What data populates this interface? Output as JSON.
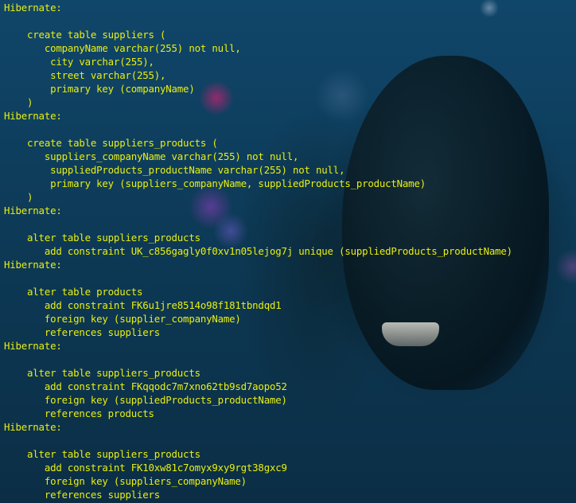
{
  "terminal": {
    "lines": [
      "Hibernate:",
      "",
      "    create table suppliers (",
      "       companyName varchar(255) not null,",
      "        city varchar(255),",
      "        street varchar(255),",
      "        primary key (companyName)",
      "    )",
      "Hibernate:",
      "",
      "    create table suppliers_products (",
      "       suppliers_companyName varchar(255) not null,",
      "        suppliedProducts_productName varchar(255) not null,",
      "        primary key (suppliers_companyName, suppliedProducts_productName)",
      "    )",
      "Hibernate:",
      "",
      "    alter table suppliers_products",
      "       add constraint UK_c856gagly0f0xv1n05lejog7j unique (suppliedProducts_productName)",
      "Hibernate:",
      "",
      "    alter table products",
      "       add constraint FK6u1jre8514o98f181tbndqd1",
      "       foreign key (supplier_companyName)",
      "       references suppliers",
      "Hibernate:",
      "",
      "    alter table suppliers_products",
      "       add constraint FKqqodc7m7xno62tb9sd7aopo52",
      "       foreign key (suppliedProducts_productName)",
      "       references products",
      "Hibernate:",
      "",
      "    alter table suppliers_products",
      "       add constraint FK10xw81c7omyx9xy9rgt38gxc9",
      "       foreign key (suppliers_companyName)",
      "       references suppliers"
    ]
  },
  "colors": {
    "text": "#e8ef10",
    "background": "#0e3a56"
  }
}
